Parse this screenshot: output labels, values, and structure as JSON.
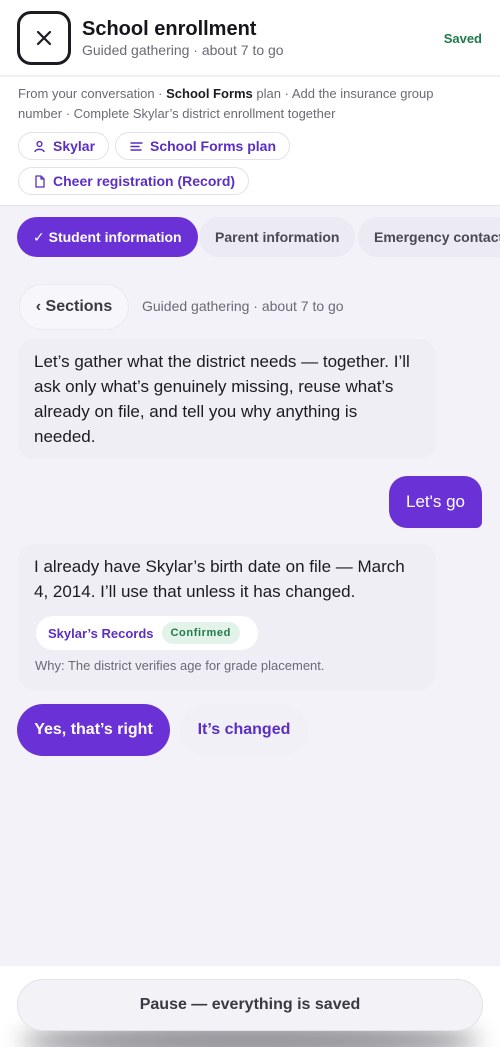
{
  "header": {
    "title": "School enrollment",
    "subtitle": "Guided gathering · about 7 to go",
    "status": "Saved"
  },
  "context": {
    "prefix": "From your conversation · ",
    "plan_name": "School Forms",
    "suffix": " plan · Add the insurance group number · Complete Skylar’s district enrollment together",
    "chips": [
      {
        "label": "Skylar",
        "icon": "person-icon"
      },
      {
        "label": "School Forms plan",
        "icon": "list-icon"
      },
      {
        "label": "Cheer registration (Record)",
        "icon": "document-icon"
      }
    ]
  },
  "tabs": [
    {
      "label": "✓ Student information",
      "active": true
    },
    {
      "label": "Parent information",
      "active": false
    },
    {
      "label": "Emergency contacts",
      "active": false
    }
  ],
  "sections": {
    "button_label": "‹ Sections",
    "meta": "Guided gathering · about 7 to go"
  },
  "messages": {
    "intro": "Let’s gather what the district needs — together. I’ll ask only what’s genuinely missing, reuse what’s already on file, and tell you why anything is needed.",
    "user_reply": "Let's go",
    "birthdate": "I already have Skylar’s birth date on file — March 4, 2014. I’ll use that unless it has changed.",
    "record_source": "Skylar’s Records",
    "record_status": "Confirmed",
    "why": "Why: The district verifies age for grade placement."
  },
  "actions": {
    "confirm": "Yes, that’s right",
    "changed": "It’s changed"
  },
  "footer": {
    "pause": "Pause — everything is saved"
  },
  "colors": {
    "accent": "#6a32d6",
    "success": "#1f7a4a"
  }
}
